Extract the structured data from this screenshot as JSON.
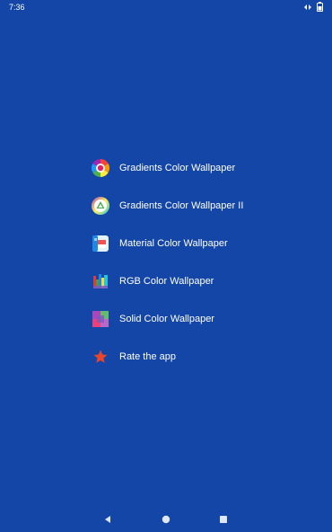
{
  "status_bar": {
    "time": "7:36",
    "icons": [
      "sync-icon",
      "battery-icon"
    ]
  },
  "menu": {
    "items": [
      {
        "label": "Gradients Color Wallpaper",
        "icon": "gradient-wheel-icon"
      },
      {
        "label": "Gradients Color Wallpaper II",
        "icon": "gradient-triangle-icon"
      },
      {
        "label": "Material Color Wallpaper",
        "icon": "material-card-icon"
      },
      {
        "label": "RGB Color Wallpaper",
        "icon": "rgb-bars-icon"
      },
      {
        "label": "Solid Color Wallpaper",
        "icon": "solid-squares-icon"
      },
      {
        "label": "Rate the app",
        "icon": "star-icon"
      }
    ]
  },
  "nav_bar": {
    "buttons": [
      "back-icon",
      "home-icon",
      "recents-icon"
    ]
  },
  "colors": {
    "background": "#1346a6",
    "text": "#ffffff",
    "star": "#e8452c"
  }
}
